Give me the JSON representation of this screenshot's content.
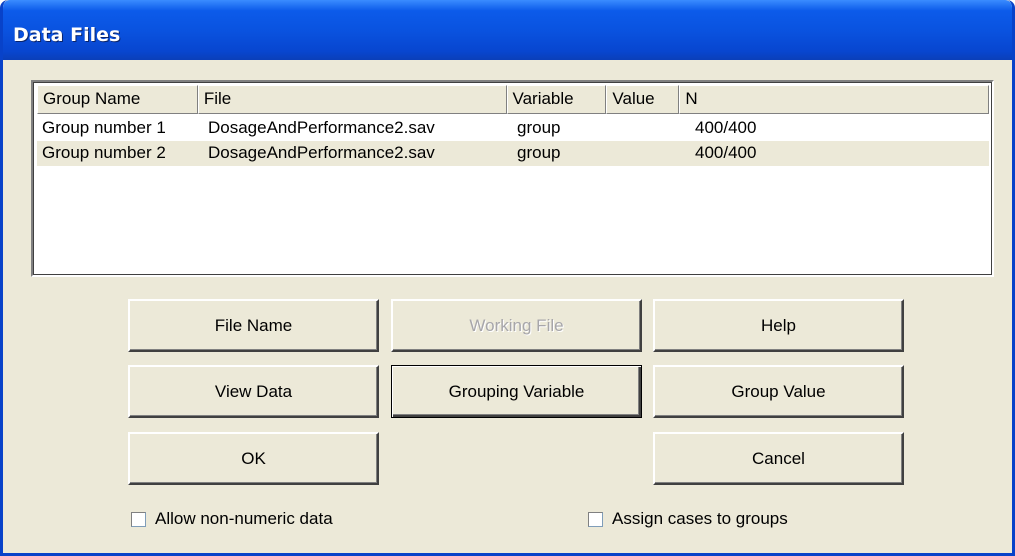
{
  "window": {
    "title": "Data Files"
  },
  "table": {
    "columns": [
      "Group Name",
      "File",
      "Variable",
      "Value",
      "N"
    ],
    "rows": [
      [
        "Group number 1",
        "DosageAndPerformance2.sav",
        "group",
        "",
        "400/400"
      ],
      [
        "Group number 2",
        "DosageAndPerformance2.sav",
        "group",
        "",
        "400/400"
      ]
    ]
  },
  "buttons": {
    "file_name": "File Name",
    "working_file": "Working File",
    "help": "Help",
    "view_data": "View Data",
    "grouping_variable": "Grouping Variable",
    "group_value": "Group Value",
    "ok": "OK",
    "cancel": "Cancel"
  },
  "options": {
    "allow_non_numeric": "Allow non-numeric data",
    "assign_cases": "Assign cases to groups"
  },
  "colors": {
    "titlebar": "#0A53E0",
    "dialog_bg": "#ECE9D8"
  }
}
